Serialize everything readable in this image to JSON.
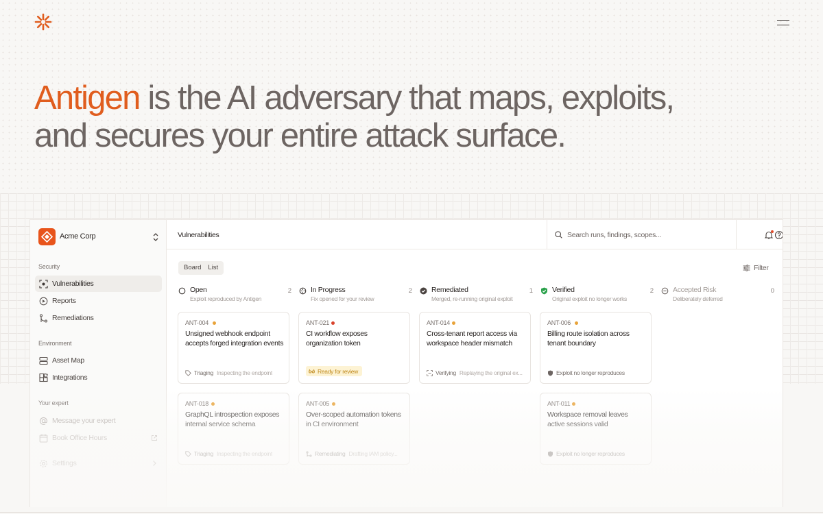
{
  "hero": {
    "accent": "Antigen",
    "rest_line1": " is the AI adversary that maps, exploits,",
    "line2": "and secures your entire attack surface."
  },
  "org": {
    "name": "Acme Corp"
  },
  "sidebar": {
    "sections": {
      "security": "Security",
      "environment": "Environment",
      "expert": "Your expert"
    },
    "items": {
      "vulnerabilities": "Vulnerabilities",
      "reports": "Reports",
      "remediations": "Remediations",
      "asset_map": "Asset Map",
      "integrations": "Integrations",
      "message_expert": "Message your expert",
      "book_office_hours": "Book Office Hours",
      "settings": "Settings"
    }
  },
  "topbar": {
    "breadcrumb": "Vulnerabilities",
    "search_placeholder": "Search runs, findings, scopes..."
  },
  "toolbar": {
    "board": "Board",
    "list": "List",
    "filter": "Filter"
  },
  "columns": [
    {
      "title": "Open",
      "subtitle": "Exploit reproduced by Antigen",
      "count": "2"
    },
    {
      "title": "In Progress",
      "subtitle": "Fix opened for your review",
      "count": "2"
    },
    {
      "title": "Remediated",
      "subtitle": "Merged, re-running original exploit",
      "count": "1"
    },
    {
      "title": "Verified",
      "subtitle": "Original exploit no longer works",
      "count": "2"
    },
    {
      "title": "Accepted Risk",
      "subtitle": "Deliberately deferred",
      "count": "0"
    }
  ],
  "cards": {
    "c1": {
      "id": "ANT-004",
      "title": "Unsigned webhook endpoint accepts forged integration events",
      "status": "Triaging",
      "detail": "Inspecting the endpoint"
    },
    "c2": {
      "id": "ANT-021",
      "title": "CI workflow exposes organization token",
      "badge": "Ready for review"
    },
    "c3": {
      "id": "ANT-014",
      "title": "Cross-tenant report access via workspace header mismatch",
      "status": "Verifying",
      "detail": "Replaying the original ex..."
    },
    "c4": {
      "id": "ANT-006",
      "title": "Billing route isolation across tenant boundary",
      "status": "Exploit no longer reproduces"
    },
    "c5": {
      "id": "ANT-018",
      "title": "GraphQL introspection exposes internal service schema",
      "status": "Triaging",
      "detail": "Inspecting the endpoint"
    },
    "c6": {
      "id": "ANT-005",
      "title": "Over-scoped automation tokens in CI environment",
      "status": "Remediating",
      "detail": "Drafting IAM policy..."
    },
    "c7": {
      "id": "ANT-011",
      "title": "Workspace removal leaves active sessions valid",
      "status": "Exploit no longer reproduces"
    }
  },
  "colors": {
    "accent": "#e05d1e",
    "priority_medium": "#e8a33a",
    "priority_high": "#d9432c",
    "verified": "#2aa14b"
  }
}
